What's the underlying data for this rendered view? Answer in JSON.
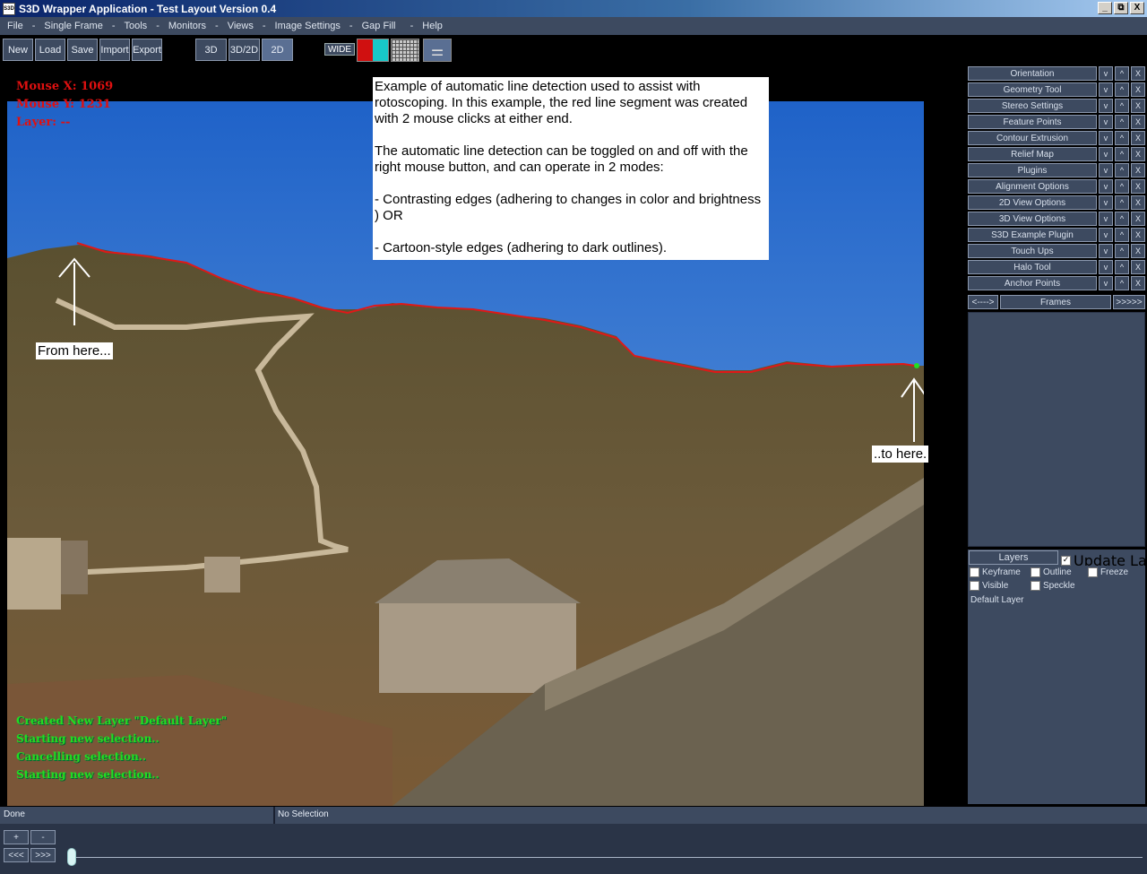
{
  "window": {
    "title": "S3D Wrapper Application - Test Layout Version 0.4",
    "icon_label": "S3D",
    "buttons": [
      "_",
      "⧉",
      "X"
    ]
  },
  "menu": [
    "File",
    "Single Frame",
    "Tools",
    "Monitors",
    "Views",
    "Image Settings",
    "Gap Fill",
    "Help"
  ],
  "toolbar": {
    "new": "New",
    "load": "Load",
    "save": "Save",
    "import": "Import",
    "export": "Export",
    "mode_3d": "3D",
    "mode_3d2d": "3D/2D",
    "mode_2d": "2D",
    "active_mode": "2D",
    "wide": "WIDE",
    "color_left": "#d01010",
    "color_right": "#18c8c8"
  },
  "viewport": {
    "mouse_x": "Mouse X: 1069",
    "mouse_y": "Mouse Y: 1231",
    "layer": "Layer: --",
    "log": [
      "Created New Layer \"Default Layer\"",
      "Starting new selection..",
      "Cancelling selection..",
      "Starting new selection.."
    ],
    "note": [
      "Example of automatic line detection used to assist with rotoscoping. In this example, the red line segment was created with 2 mouse clicks at either end.",
      "The automatic line detection can be toggled on and off with the right mouse button, and can operate in 2 modes:",
      " - Contrasting edges (adhering to changes in color and brightness ) OR",
      " - Cartoon-style edges (adhering to dark outlines)."
    ],
    "from_label": "From here...",
    "to_label": "..to here."
  },
  "panel": {
    "tools": [
      "Orientation",
      "Geometry Tool",
      "Stereo Settings",
      "Feature Points",
      "Contour Extrusion",
      "Relief Map",
      "Plugins",
      "Alignment Options",
      "2D View Options",
      "3D View Options",
      "S3D Example Plugin",
      "Touch Ups",
      "Halo Tool",
      "Anchor Points"
    ],
    "row_buttons": [
      "v",
      "^",
      "X"
    ],
    "frames": {
      "prev": "<---->",
      "label": "Frames",
      "next": ">>>>>"
    },
    "layers": {
      "title": "Layers",
      "update": "Update Layers",
      "update_checked": true,
      "keyframe": "Keyframe",
      "outline": "Outline",
      "freeze": "Freeze",
      "visible": "Visible",
      "speckle": "Speckle",
      "items": [
        "Default Layer"
      ]
    }
  },
  "status": {
    "left": "Done",
    "right": "No Selection"
  },
  "bottom": {
    "plus": "+",
    "minus": "-",
    "rewind": "<<<",
    "forward": ">>>",
    "position": 0
  }
}
